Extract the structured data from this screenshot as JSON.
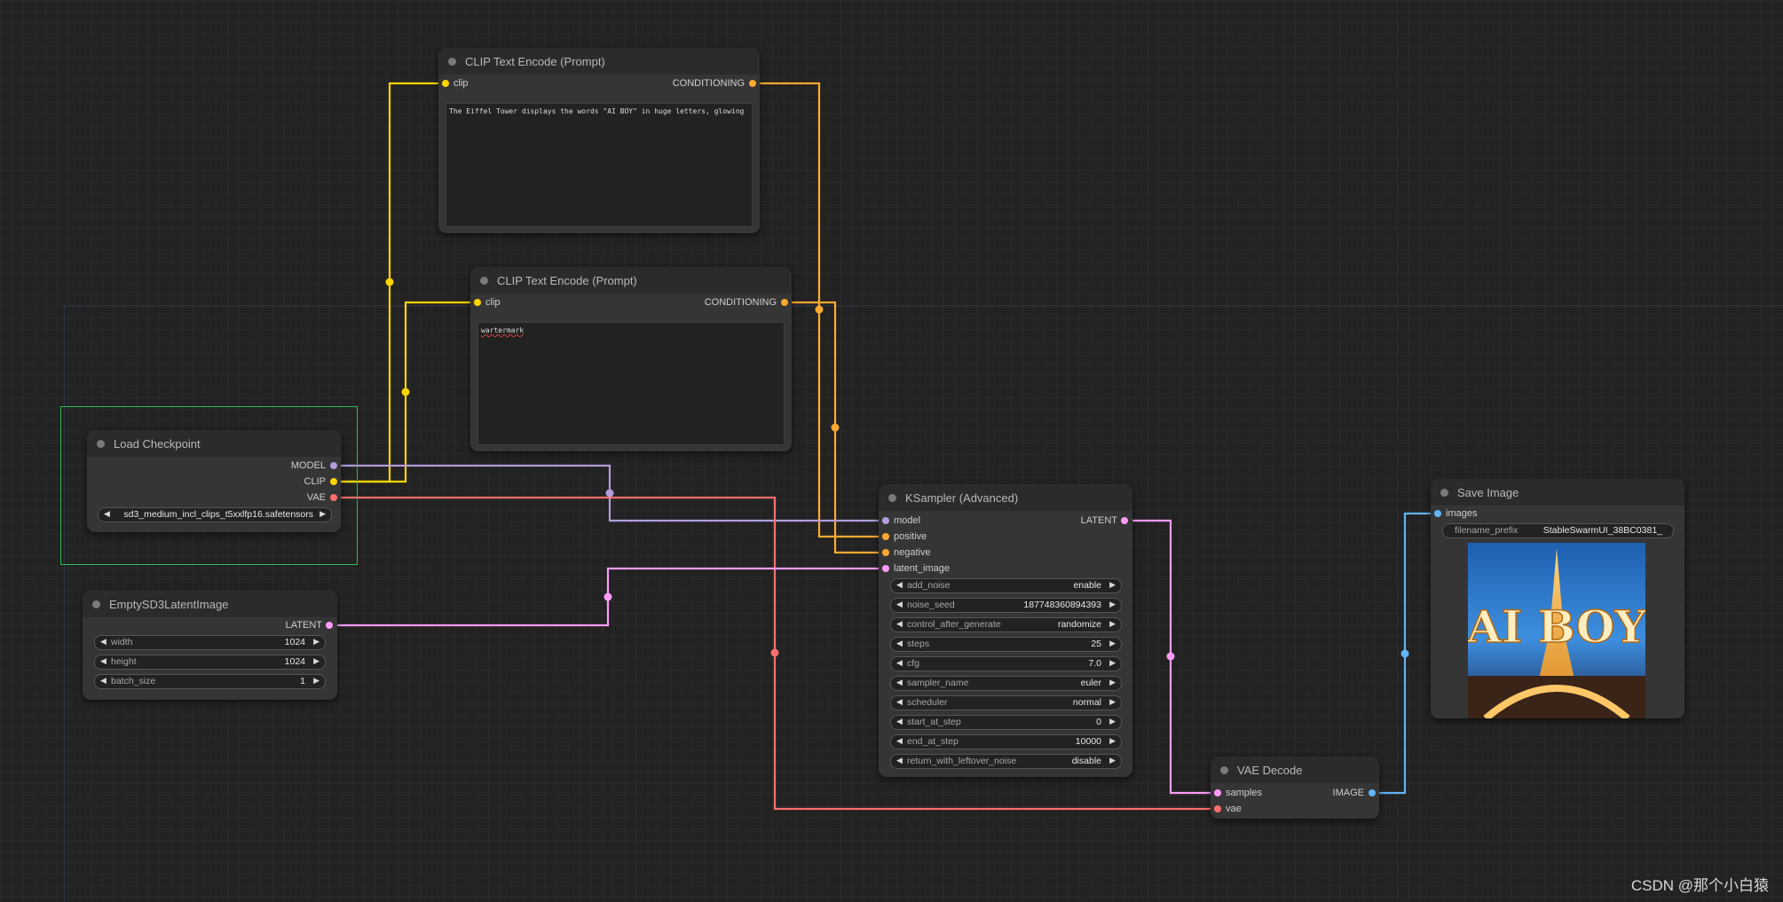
{
  "nodes": {
    "clip_text_1": {
      "title": "CLIP Text Encode (Prompt)",
      "input_clip": "clip",
      "output": "CONDITIONING",
      "text": "The Eiffel Tower displays the words \"AI BOY\" in huge letters, glowing"
    },
    "clip_text_2": {
      "title": "CLIP Text Encode (Prompt)",
      "input_clip": "clip",
      "output": "CONDITIONING",
      "text": "wartermark"
    },
    "load_checkpoint": {
      "title": "Load Checkpoint",
      "outputs": [
        "MODEL",
        "CLIP",
        "VAE"
      ],
      "ckpt_name": "sd3_medium_incl_clips_t5xxlfp16.safetensors"
    },
    "empty_latent": {
      "title": "EmptySD3LatentImage",
      "output": "LATENT",
      "widgets": [
        {
          "name": "width",
          "value": "1024"
        },
        {
          "name": "height",
          "value": "1024"
        },
        {
          "name": "batch_size",
          "value": "1"
        }
      ]
    },
    "ksampler": {
      "title": "KSampler (Advanced)",
      "inputs": [
        "model",
        "positive",
        "negative",
        "latent_image"
      ],
      "output": "LATENT",
      "widgets": [
        {
          "name": "add_noise",
          "value": "enable"
        },
        {
          "name": "noise_seed",
          "value": "187748360894393"
        },
        {
          "name": "control_after_generate",
          "value": "randomize"
        },
        {
          "name": "steps",
          "value": "25"
        },
        {
          "name": "cfg",
          "value": "7.0"
        },
        {
          "name": "sampler_name",
          "value": "euler"
        },
        {
          "name": "scheduler",
          "value": "normal"
        },
        {
          "name": "start_at_step",
          "value": "0"
        },
        {
          "name": "end_at_step",
          "value": "10000"
        },
        {
          "name": "return_with_leftover_noise",
          "value": "disable"
        }
      ]
    },
    "vae_decode": {
      "title": "VAE Decode",
      "inputs": [
        "samples",
        "vae"
      ],
      "output": "IMAGE"
    },
    "save_image": {
      "title": "Save Image",
      "input": "images",
      "widget": {
        "name": "filename_prefix",
        "value": "StableSwarmUI_38BC0381_"
      },
      "preview_text": "AI BOY"
    }
  },
  "colors": {
    "clip": "#ffd500",
    "conditioning": "#ffa931",
    "model": "#b39ddb",
    "vae": "#ff6e6e",
    "latent": "#ff9cf9",
    "image": "#64b5f6",
    "selection": "#2ebc4f"
  },
  "watermark": "CSDN @那个小白猿"
}
